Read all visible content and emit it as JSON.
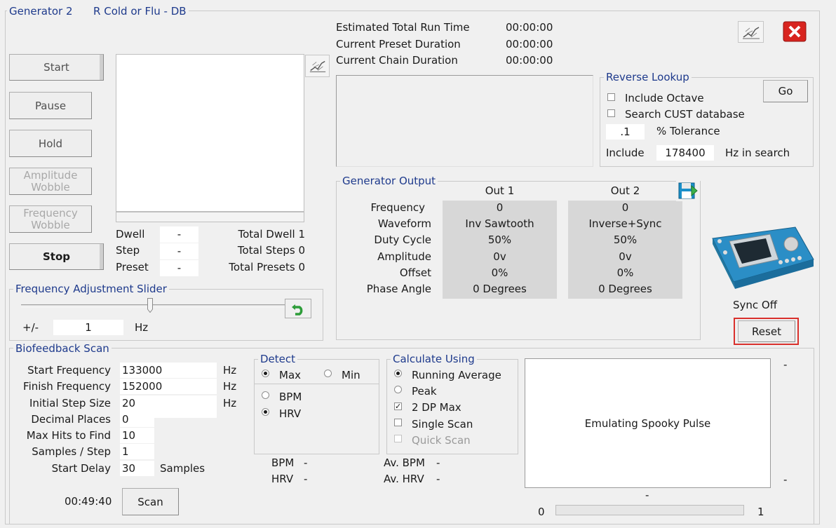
{
  "window": {
    "generator_name": "Generator 2",
    "preset_name": "R Cold or Flu - DB"
  },
  "controls": {
    "start": "Start",
    "pause": "Pause",
    "hold": "Hold",
    "amplitude_wobble": "Amplitude\nWobble",
    "frequency_wobble": "Frequency\nWobble",
    "stop": "Stop"
  },
  "run_times": [
    {
      "label": "Estimated Total Run Time",
      "value": "00:00:00"
    },
    {
      "label": "Current Preset Duration",
      "value": "00:00:00"
    },
    {
      "label": "Current Chain Duration",
      "value": "00:00:00"
    }
  ],
  "progress": {
    "dwell_label": "Dwell",
    "dwell_value": "-",
    "step_label": "Step",
    "step_value": "-",
    "preset_label": "Preset",
    "preset_value": "-",
    "total_dwell": "Total Dwell 1",
    "total_steps": "Total Steps 0",
    "total_presets": "Total Presets 0"
  },
  "reverse_lookup": {
    "title": "Reverse Lookup",
    "include_octave": "Include Octave",
    "search_cust": "Search CUST database",
    "tolerance_value": ".1",
    "tolerance_label": "% Tolerance",
    "include_label": "Include",
    "include_value": "178400",
    "hz_in_search": "Hz in search",
    "go": "Go"
  },
  "generator_output": {
    "title": "Generator Output",
    "out1_header": "Out 1",
    "out2_header": "Out 2",
    "rows": [
      {
        "label": "Frequency",
        "out1": "0",
        "out2": "0"
      },
      {
        "label": "Waveform",
        "out1": "Inv Sawtooth",
        "out2": "Inverse+Sync"
      },
      {
        "label": "Duty Cycle",
        "out1": "50%",
        "out2": "50%"
      },
      {
        "label": "Amplitude",
        "out1": "0v",
        "out2": "0v"
      },
      {
        "label": "Offset",
        "out1": "0%",
        "out2": "0%"
      },
      {
        "label": "Phase Angle",
        "out1": "0 Degrees",
        "out2": "0 Degrees"
      }
    ]
  },
  "device": {
    "sync_status": "Sync Off",
    "reset": "Reset"
  },
  "freq_slider": {
    "title": "Frequency Adjustment Slider",
    "plus_minus": "+/-",
    "value": "1",
    "unit": "Hz",
    "position": 0.49
  },
  "biofeedback": {
    "title": "Biofeedback Scan",
    "fields": [
      {
        "label": "Start Frequency",
        "value": "133000",
        "unit": "Hz"
      },
      {
        "label": "Finish Frequency",
        "value": "152000",
        "unit": "Hz"
      },
      {
        "label": "Initial Step Size",
        "value": "20",
        "unit": "Hz"
      },
      {
        "label": "Decimal Places",
        "value": "0",
        "unit": ""
      },
      {
        "label": "Max Hits to Find",
        "value": "10",
        "unit": ""
      },
      {
        "label": "Samples / Step",
        "value": "1",
        "unit": ""
      },
      {
        "label": "Start Delay",
        "value": "30",
        "unit": "Samples"
      }
    ],
    "elapsed": "00:49:40",
    "scan": "Scan",
    "detect": {
      "title": "Detect",
      "max": "Max",
      "min": "Min",
      "bpm": "BPM",
      "hrv": "HRV"
    },
    "bpm_label": "BPM",
    "bpm_value": "-",
    "hrv_label": "HRV",
    "hrv_value": "-",
    "calculate": {
      "title": "Calculate Using",
      "running_average": "Running Average",
      "peak": "Peak",
      "two_dp_max": "2 DP Max",
      "single_scan": "Single Scan",
      "quick_scan": "Quick Scan"
    },
    "avg_bpm_label": "Av. BPM",
    "avg_bpm_value": "-",
    "avg_hrv_label": "Av. HRV",
    "avg_hrv_value": "-",
    "graph_message": "Emulating Spooky Pulse",
    "graph_top_dash": "-",
    "graph_bottom_dash": "-",
    "graph_mid_dash": "-",
    "progress_min": "0",
    "progress_max": "1"
  },
  "colors": {
    "accent": "#1e3a8c",
    "close_red": "#d8241f",
    "highlight_red": "#d9302c"
  }
}
